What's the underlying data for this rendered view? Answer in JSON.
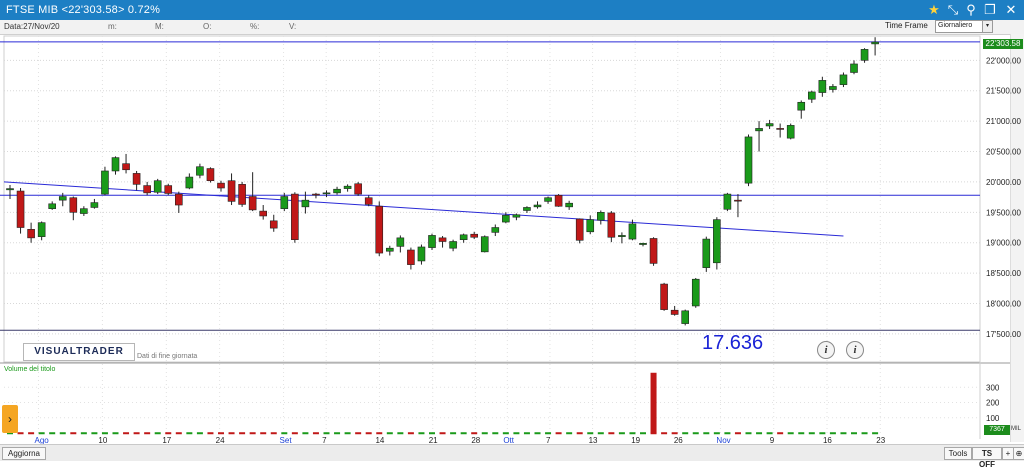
{
  "window": {
    "title": "FTSE MIB <22'303.58> 0.72%",
    "icons": [
      "star-icon",
      "collapse-arrow-icon",
      "pin-icon",
      "restore-icon",
      "close-icon"
    ]
  },
  "info_bar": {
    "date": "Data:27/Nov/20",
    "max": "m:",
    "min": "M:",
    "open": "O:",
    "pct": "%:",
    "vol": "V:"
  },
  "toolbar": {
    "time_frame_label": "Time Frame",
    "time_frame_value": "Giornaliero"
  },
  "price_axis": {
    "ticks": [
      "22'000.00",
      "21'500.00",
      "21'000.00",
      "20'500.00",
      "20'000.00",
      "19'500.00",
      "19'000.00",
      "18'500.00",
      "18'000.00",
      "17'500.00"
    ],
    "last_price": "22'303.58"
  },
  "volume_axis": {
    "ticks": [
      "300",
      "200",
      "100"
    ],
    "badge": "7367",
    "unit": "MIL"
  },
  "x_axis": {
    "labels": [
      "Ago",
      "10",
      "17",
      "24",
      "Set",
      "7",
      "14",
      "21",
      "28",
      "Ott",
      "7",
      "13",
      "19",
      "26",
      "Nov",
      "9",
      "16",
      "23"
    ]
  },
  "overlay": {
    "logo": "VISUALTRADER",
    "logo_sub": "Dati di fine giornata",
    "big_value": "17.636",
    "volume_title": "Volume del titolo"
  },
  "bottom_bar": {
    "update_label": "Aggiorna",
    "tools_label": "Tools",
    "ts_label": "TS OFF"
  },
  "chart_data": {
    "type": "candlestick",
    "ylim": [
      17400,
      22400
    ],
    "x_labels": [
      "Ago",
      "10",
      "17",
      "24",
      "Set",
      "7",
      "14",
      "21",
      "28",
      "Ott",
      "7",
      "13",
      "19",
      "26",
      "Nov",
      "9",
      "16",
      "23"
    ],
    "candles": [
      {
        "o": 19870,
        "h": 19950,
        "l": 19720,
        "c": 19890
      },
      {
        "o": 19850,
        "h": 19900,
        "l": 19150,
        "c": 19250
      },
      {
        "o": 19220,
        "h": 19330,
        "l": 19000,
        "c": 19080
      },
      {
        "o": 19100,
        "h": 19350,
        "l": 19040,
        "c": 19330
      },
      {
        "o": 19560,
        "h": 19680,
        "l": 19540,
        "c": 19640
      },
      {
        "o": 19700,
        "h": 19820,
        "l": 19600,
        "c": 19760
      },
      {
        "o": 19740,
        "h": 19760,
        "l": 19370,
        "c": 19500
      },
      {
        "o": 19480,
        "h": 19600,
        "l": 19440,
        "c": 19560
      },
      {
        "o": 19580,
        "h": 19720,
        "l": 19560,
        "c": 19660
      },
      {
        "o": 19800,
        "h": 20250,
        "l": 19780,
        "c": 20180
      },
      {
        "o": 20180,
        "h": 20420,
        "l": 20120,
        "c": 20400
      },
      {
        "o": 20300,
        "h": 20460,
        "l": 20140,
        "c": 20200
      },
      {
        "o": 20140,
        "h": 20180,
        "l": 19860,
        "c": 19960
      },
      {
        "o": 19940,
        "h": 20000,
        "l": 19780,
        "c": 19820
      },
      {
        "o": 19830,
        "h": 20050,
        "l": 19800,
        "c": 20020
      },
      {
        "o": 19940,
        "h": 19970,
        "l": 19780,
        "c": 19810
      },
      {
        "o": 19800,
        "h": 19840,
        "l": 19490,
        "c": 19620
      },
      {
        "o": 19900,
        "h": 20140,
        "l": 19880,
        "c": 20080
      },
      {
        "o": 20110,
        "h": 20300,
        "l": 20060,
        "c": 20250
      },
      {
        "o": 20220,
        "h": 20240,
        "l": 19990,
        "c": 20020
      },
      {
        "o": 19980,
        "h": 20020,
        "l": 19840,
        "c": 19900
      },
      {
        "o": 20020,
        "h": 20140,
        "l": 19620,
        "c": 19680
      },
      {
        "o": 19960,
        "h": 20000,
        "l": 19590,
        "c": 19630
      },
      {
        "o": 19760,
        "h": 20160,
        "l": 19520,
        "c": 19540
      },
      {
        "o": 19520,
        "h": 19620,
        "l": 19380,
        "c": 19440
      },
      {
        "o": 19360,
        "h": 19460,
        "l": 19180,
        "c": 19240
      },
      {
        "o": 19560,
        "h": 19820,
        "l": 19520,
        "c": 19760
      },
      {
        "o": 19800,
        "h": 19830,
        "l": 19000,
        "c": 19050
      },
      {
        "o": 19590,
        "h": 19840,
        "l": 19480,
        "c": 19700
      },
      {
        "o": 19800,
        "h": 19820,
        "l": 19730,
        "c": 19790
      },
      {
        "o": 19810,
        "h": 19860,
        "l": 19750,
        "c": 19820
      },
      {
        "o": 19820,
        "h": 19920,
        "l": 19790,
        "c": 19880
      },
      {
        "o": 19890,
        "h": 19960,
        "l": 19840,
        "c": 19930
      },
      {
        "o": 19970,
        "h": 20000,
        "l": 19770,
        "c": 19800
      },
      {
        "o": 19740,
        "h": 19780,
        "l": 19600,
        "c": 19630
      },
      {
        "o": 19600,
        "h": 19680,
        "l": 18780,
        "c": 18830
      },
      {
        "o": 18860,
        "h": 18950,
        "l": 18790,
        "c": 18910
      },
      {
        "o": 18940,
        "h": 19120,
        "l": 18840,
        "c": 19080
      },
      {
        "o": 18880,
        "h": 18920,
        "l": 18560,
        "c": 18640
      },
      {
        "o": 18700,
        "h": 18970,
        "l": 18640,
        "c": 18930
      },
      {
        "o": 18920,
        "h": 19150,
        "l": 18880,
        "c": 19120
      },
      {
        "o": 19080,
        "h": 19110,
        "l": 18920,
        "c": 19020
      },
      {
        "o": 18910,
        "h": 19050,
        "l": 18860,
        "c": 19020
      },
      {
        "o": 19050,
        "h": 19150,
        "l": 19000,
        "c": 19130
      },
      {
        "o": 19140,
        "h": 19180,
        "l": 19060,
        "c": 19090
      },
      {
        "o": 18850,
        "h": 19120,
        "l": 18840,
        "c": 19100
      },
      {
        "o": 19170,
        "h": 19300,
        "l": 19110,
        "c": 19250
      },
      {
        "o": 19340,
        "h": 19500,
        "l": 19320,
        "c": 19450
      },
      {
        "o": 19420,
        "h": 19480,
        "l": 19370,
        "c": 19460
      },
      {
        "o": 19530,
        "h": 19600,
        "l": 19490,
        "c": 19580
      },
      {
        "o": 19590,
        "h": 19680,
        "l": 19560,
        "c": 19620
      },
      {
        "o": 19680,
        "h": 19760,
        "l": 19640,
        "c": 19740
      },
      {
        "o": 19780,
        "h": 19800,
        "l": 19590,
        "c": 19600
      },
      {
        "o": 19590,
        "h": 19690,
        "l": 19540,
        "c": 19650
      },
      {
        "o": 19390,
        "h": 19400,
        "l": 18990,
        "c": 19040
      },
      {
        "o": 19180,
        "h": 19450,
        "l": 19140,
        "c": 19380
      },
      {
        "o": 19370,
        "h": 19530,
        "l": 19300,
        "c": 19500
      },
      {
        "o": 19490,
        "h": 19520,
        "l": 19010,
        "c": 19090
      },
      {
        "o": 19100,
        "h": 19170,
        "l": 18990,
        "c": 19120
      },
      {
        "o": 19060,
        "h": 19380,
        "l": 19040,
        "c": 19310
      },
      {
        "o": 18970,
        "h": 19000,
        "l": 18940,
        "c": 18990
      },
      {
        "o": 19070,
        "h": 19090,
        "l": 18620,
        "c": 18660
      },
      {
        "o": 18320,
        "h": 18340,
        "l": 17880,
        "c": 17900
      },
      {
        "o": 17890,
        "h": 17960,
        "l": 17800,
        "c": 17820
      },
      {
        "o": 17670,
        "h": 17900,
        "l": 17640,
        "c": 17880
      },
      {
        "o": 17960,
        "h": 18420,
        "l": 17930,
        "c": 18400
      },
      {
        "o": 18590,
        "h": 19100,
        "l": 18520,
        "c": 19060
      },
      {
        "o": 18670,
        "h": 19420,
        "l": 18560,
        "c": 19380
      },
      {
        "o": 19550,
        "h": 19820,
        "l": 19520,
        "c": 19800
      },
      {
        "o": 19700,
        "h": 19800,
        "l": 19420,
        "c": 19690
      },
      {
        "o": 19980,
        "h": 20780,
        "l": 19930,
        "c": 20740
      },
      {
        "o": 20840,
        "h": 21000,
        "l": 20500,
        "c": 20880
      },
      {
        "o": 20920,
        "h": 21020,
        "l": 20870,
        "c": 20960
      },
      {
        "o": 20880,
        "h": 20960,
        "l": 20730,
        "c": 20870
      },
      {
        "o": 20720,
        "h": 20960,
        "l": 20700,
        "c": 20930
      },
      {
        "o": 21180,
        "h": 21340,
        "l": 21040,
        "c": 21310
      },
      {
        "o": 21360,
        "h": 21500,
        "l": 21300,
        "c": 21480
      },
      {
        "o": 21470,
        "h": 21730,
        "l": 21400,
        "c": 21670
      },
      {
        "o": 21520,
        "h": 21610,
        "l": 21470,
        "c": 21570
      },
      {
        "o": 21600,
        "h": 21800,
        "l": 21560,
        "c": 21760
      },
      {
        "o": 21800,
        "h": 22000,
        "l": 21770,
        "c": 21940
      },
      {
        "o": 22000,
        "h": 22200,
        "l": 21960,
        "c": 22180
      },
      {
        "o": 22270,
        "h": 22380,
        "l": 22080,
        "c": 22300
      }
    ],
    "volume": {
      "ylim": [
        0,
        400
      ],
      "spike_index": 61,
      "spike_value": 395,
      "baseline_value": 5
    },
    "horizontal_lines": [
      22303,
      19780,
      17560
    ],
    "trendline": {
      "from": [
        0,
        20000
      ],
      "to": [
        79,
        19110
      ]
    }
  }
}
